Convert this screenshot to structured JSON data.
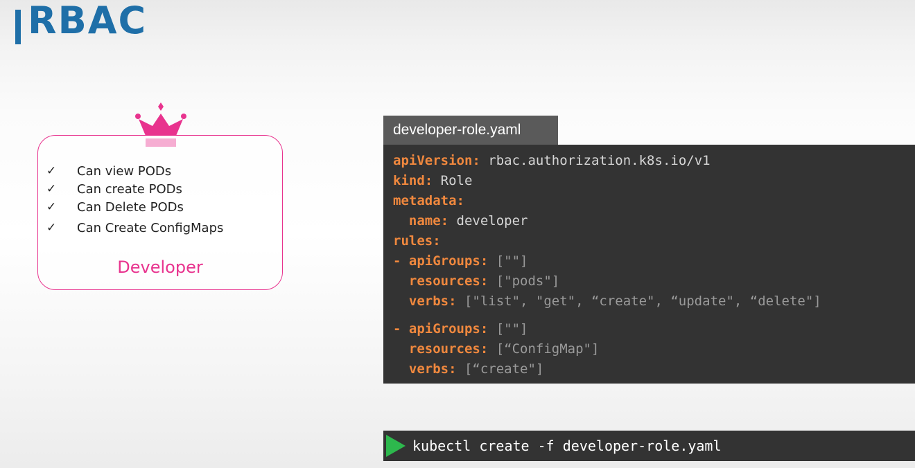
{
  "title": "RBAC",
  "colors": {
    "title": "#1f6fa8",
    "accent": "#e8338e",
    "code_background": "#333333",
    "code_key": "#f0883e",
    "terminal_play": "#2db84d"
  },
  "role_card": {
    "icon": "crown-icon",
    "permissions": [
      "Can view PODs",
      "Can create PODs",
      "Can Delete PODs",
      "Can Create ConfigMaps"
    ],
    "check_mark": "✓",
    "role_name": "Developer"
  },
  "file": {
    "tab_label": "developer-role.yaml"
  },
  "code": {
    "line1_key": "apiVersion:",
    "line1_val": " rbac.authorization.k8s.io/v1",
    "line2_key": "kind:",
    "line2_val": " Role",
    "line3_key": "metadata:",
    "line4_key": "  name:",
    "line4_val": " developer",
    "line5_key": "rules:",
    "line6_dash": "- ",
    "line6_key": "apiGroups:",
    "line6_val": " [\"\"]",
    "line7_key": "  resources:",
    "line7_val": " [\"pods\"]",
    "line8_key": "  verbs:",
    "line8_val": " [\"list\", \"get\", “create\", “update\", “delete\"]",
    "line9_dash": "- ",
    "line9_key": "apiGroups:",
    "line9_val": " [\"\"]",
    "line10_key": "  resources:",
    "line10_val": " [“ConfigMap\"]",
    "line11_key": "  verbs:",
    "line11_val": " [“create\"]"
  },
  "terminal": {
    "icon": "play-icon",
    "command": "kubectl create -f developer-role.yaml"
  }
}
